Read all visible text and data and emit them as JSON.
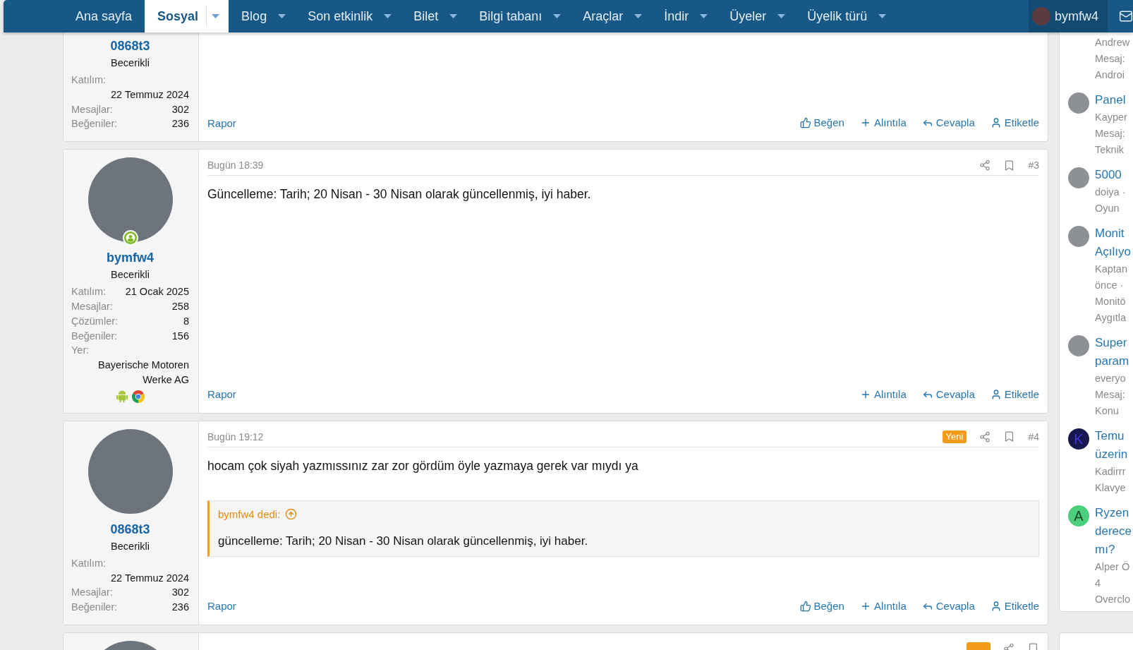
{
  "nav": {
    "items": [
      {
        "label": "Ana sayfa",
        "selected": false,
        "has_menu": false
      },
      {
        "label": "Sosyal",
        "selected": true,
        "has_menu": true
      },
      {
        "label": "Blog",
        "selected": false,
        "has_menu": true
      },
      {
        "label": "Son etkinlik",
        "selected": false,
        "has_menu": true
      },
      {
        "label": "Bilet",
        "selected": false,
        "has_menu": true
      },
      {
        "label": "Bilgi tabanı",
        "selected": false,
        "has_menu": true
      },
      {
        "label": "Araçlar",
        "selected": false,
        "has_menu": true
      },
      {
        "label": "İndir",
        "selected": false,
        "has_menu": true
      },
      {
        "label": "Üyeler",
        "selected": false,
        "has_menu": true
      },
      {
        "label": "Üyelik türü",
        "selected": false,
        "has_menu": true
      }
    ],
    "account": {
      "name": "bymfw4"
    }
  },
  "posts": [
    {
      "author": {
        "name": "0868t3",
        "title": "Becerikli",
        "stats": [
          {
            "label": "Katılım:",
            "value": "22 Temmuz 2024"
          },
          {
            "label": "Mesajlar:",
            "value": "302"
          },
          {
            "label": "Beğeniler:",
            "value": "236"
          }
        ]
      },
      "report": "Rapor",
      "actions": [
        {
          "kind": "like",
          "label": "Beğen"
        },
        {
          "kind": "quote",
          "label": "Alıntıla"
        },
        {
          "kind": "reply",
          "label": "Cevapla"
        },
        {
          "kind": "tag",
          "label": "Etiketle"
        }
      ]
    },
    {
      "author": {
        "avatar": {
          "kind": "photo"
        },
        "online": true,
        "name": "bymfw4",
        "title": "Becerikli",
        "stats": [
          {
            "label": "Katılım:",
            "value": "21 Ocak 2025"
          },
          {
            "label": "Mesajlar:",
            "value": "258"
          },
          {
            "label": "Çözümler:",
            "value": "8"
          },
          {
            "label": "Beğeniler:",
            "value": "156"
          }
        ],
        "location_heading": "Yer:",
        "location": "Bayerische Motoren Werke AG",
        "platform_icons": [
          {
            "kind": "android"
          },
          {
            "kind": "chrome"
          }
        ]
      },
      "header": {
        "time": "Bugün 18:39",
        "number": "#3"
      },
      "body": [
        {
          "kind": "text",
          "text": "Güncelleme: Tarih; 20 Nisan - 30 Nisan olarak güncellenmiş, iyi haber."
        }
      ],
      "report": "Rapor",
      "actions": [
        {
          "kind": "quote",
          "label": "Alıntıla"
        },
        {
          "kind": "reply",
          "label": "Cevapla"
        },
        {
          "kind": "tag",
          "label": "Etiketle"
        }
      ]
    },
    {
      "author": {
        "avatar": {
          "kind": "photo"
        },
        "online": false,
        "name": "0868t3",
        "title": "Becerikli",
        "stats": [
          {
            "label": "Katılım:",
            "value": "22 Temmuz 2024"
          },
          {
            "label": "Mesajlar:",
            "value": "302"
          },
          {
            "label": "Beğeniler:",
            "value": "236"
          }
        ]
      },
      "header": {
        "time": "Bugün 19:12",
        "badge": "Yeni",
        "number": "#4"
      },
      "body": [
        {
          "kind": "text",
          "text": "hocam çok siyah yazmıssınız zar zor gördüm öyle yazmaya gerek var mıydı ya"
        },
        {
          "kind": "quote",
          "author": "bymfw4 dedi:",
          "text": "güncelleme: Tarih; 20 Nisan - 30 Nisan olarak güncellenmiş, iyi haber."
        }
      ],
      "report": "Rapor",
      "actions": [
        {
          "kind": "like",
          "label": "Beğen"
        },
        {
          "kind": "quote",
          "label": "Alıntıla"
        },
        {
          "kind": "reply",
          "label": "Cevapla"
        },
        {
          "kind": "tag",
          "label": "Etiketle"
        }
      ]
    },
    {
      "author": {
        "avatar": {
          "kind": "photo"
        }
      },
      "header": {
        "new": true
      }
    }
  ],
  "sidebar": [
    {
      "kind": "post_list",
      "items": [
        {
          "meta_lines": [
            "Andrew",
            "Mesaj:",
            "Androi"
          ]
        },
        {
          "avatar": {
            "kind": "photo"
          },
          "title_lines": [
            "Panel"
          ],
          "meta_lines": [
            "Kayper",
            "Mesaj:",
            "Teknik"
          ]
        },
        {
          "avatar": {
            "kind": "photo"
          },
          "title_lines": [
            "5000"
          ],
          "meta_lines": [
            "doiya ·",
            "Oyun"
          ]
        },
        {
          "avatar": {
            "kind": "photo"
          },
          "title_lines": [
            "Monit",
            "Açılıyo"
          ],
          "meta_lines": [
            "Kaptan",
            "önce ·",
            "Monitö",
            "Aygıtla"
          ]
        },
        {
          "avatar": {
            "kind": "photo"
          },
          "title_lines": [
            "Super",
            "param"
          ],
          "meta_lines": [
            "everyo",
            "Mesaj:",
            "Konu"
          ]
        },
        {
          "avatar": {
            "kind": "letter",
            "letter": "K",
            "color": "#17164f"
          },
          "title_lines": [
            "Temu",
            "üzerin"
          ],
          "meta_lines": [
            "Kadirrr",
            "Klavye"
          ]
        },
        {
          "avatar": {
            "kind": "letter",
            "letter": "A",
            "color": "#4ccf7c"
          },
          "title_lines": [
            "Ryzen",
            "derece",
            "mı?"
          ],
          "meta_lines": [
            "Alper Ö",
            "4",
            "Overclo"
          ]
        }
      ]
    },
    {
      "kind": "card"
    }
  ]
}
